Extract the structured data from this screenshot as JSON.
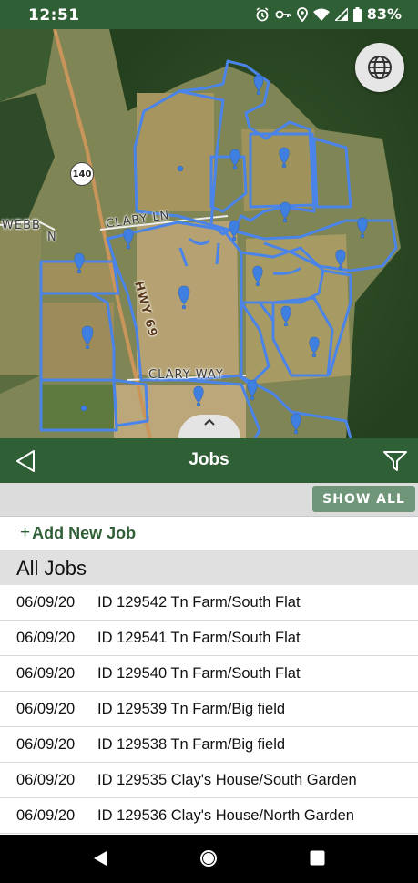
{
  "status_bar": {
    "time": "12:51",
    "battery": "83%",
    "icons": [
      "alarm-icon",
      "key-icon",
      "location-icon",
      "wifi-icon",
      "signal-icon",
      "battery-icon"
    ]
  },
  "map": {
    "road_labels": {
      "webb": "WEBB",
      "webb2": "N",
      "clary_ln": "CLARY LN",
      "hwy": "HWY 69",
      "clary_way": "CLARY WAY",
      "shield": "140"
    },
    "field_outline_color": "#4a84e8",
    "marker_color": "#3f7fe0"
  },
  "app_bar": {
    "title": "Jobs"
  },
  "show_all_label": "SHOW ALL",
  "add_job_label": "Add New Job",
  "add_job_plus": "+",
  "section_title": "All Jobs",
  "jobs": [
    {
      "date": "06/09/20",
      "desc": "ID 129542 Tn Farm/South Flat"
    },
    {
      "date": "06/09/20",
      "desc": "ID 129541 Tn Farm/South Flat"
    },
    {
      "date": "06/09/20",
      "desc": "ID 129540 Tn Farm/South Flat"
    },
    {
      "date": "06/09/20",
      "desc": "ID 129539 Tn Farm/Big field"
    },
    {
      "date": "06/09/20",
      "desc": "ID 129538 Tn Farm/Big field"
    },
    {
      "date": "06/09/20",
      "desc": "ID 129535 Clay's House/South Garden"
    },
    {
      "date": "06/09/20",
      "desc": "ID 129536 Clay's House/North Garden"
    }
  ],
  "colors": {
    "brand_green": "#2f5f35",
    "show_all_bg": "#6f9679"
  }
}
